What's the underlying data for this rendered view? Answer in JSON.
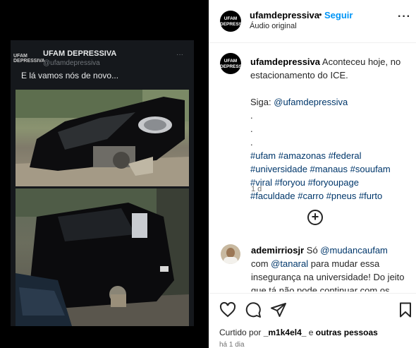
{
  "media": {
    "tweet_logo": "UFAM DEPRESSIVA",
    "tweet_name": "UFAM DEPRESSIVA",
    "tweet_handle": "@ufamdepressiva",
    "tweet_more": "···",
    "tweet_text": "E lá vamos nós de novo..."
  },
  "header": {
    "avatar_text": "UFAM DEPRESSIVA",
    "username": "ufamdepressiva",
    "dot": "•",
    "follow_label": "Seguir",
    "audio": "Áudio original",
    "more": "···"
  },
  "caption": {
    "avatar_text": "UFAM DEPRESSIVA",
    "username": "ufamdepressiva",
    "line1": "Aconteceu hoje, no estacionamento do ICE.",
    "siga_prefix": "Siga: ",
    "siga_mention": "@ufamdepressiva",
    "dots": [
      ".",
      ".",
      "."
    ],
    "hashtags": "#ufam #amazonas #federal #universidade #manaus #souufam #viral #foryou #foryoupage #faculdade #carro #pneus #furto",
    "time": "1 d"
  },
  "comment": {
    "username": "ademirriosjr",
    "prefix": "Só ",
    "mention1": "@mudancaufam",
    "mid": " com ",
    "mention2": "@tanaral",
    "text": " para mudar essa insegurança na universidade! Do jeito que tá não pode continuar com os mesmos de"
  },
  "likes": {
    "prefix": "Curtido por ",
    "user": "_m1k4el4_",
    "and": " e ",
    "others": "outras pessoas"
  },
  "date": "há 1 dia"
}
